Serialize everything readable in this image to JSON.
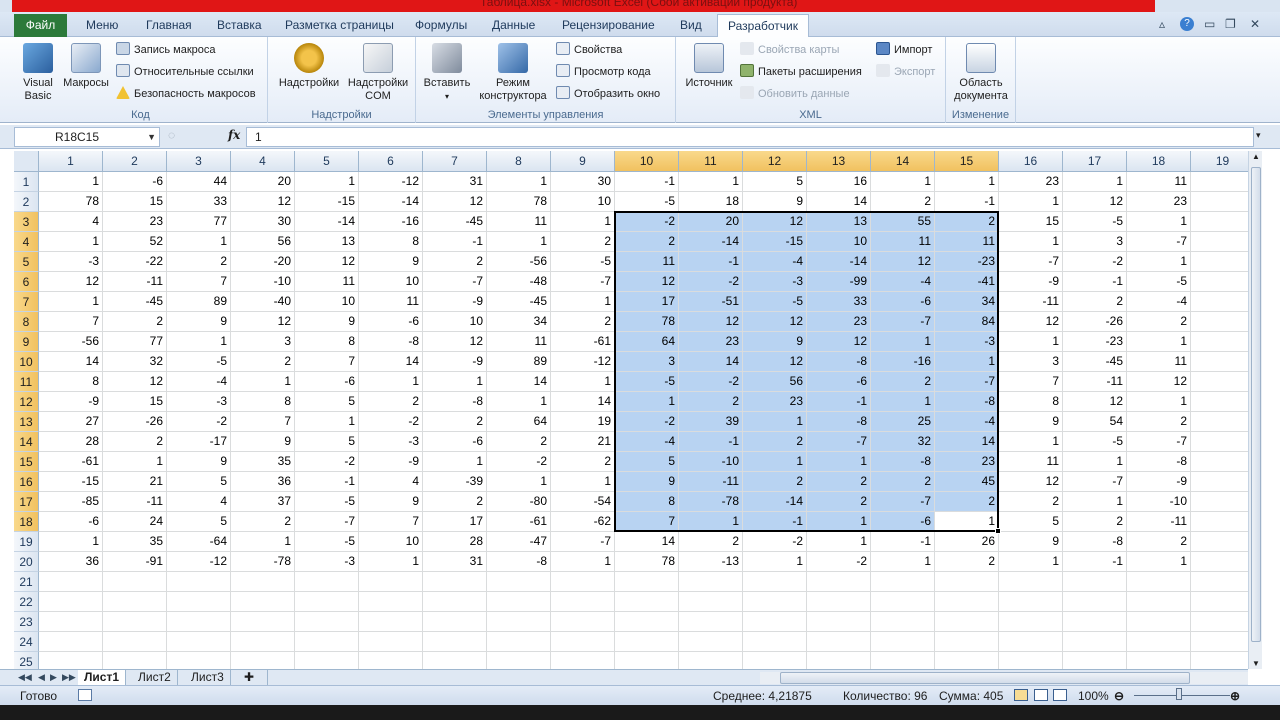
{
  "window": {
    "title": "Таблица.xlsx - Microsoft Excel (Сбой активации продукта)"
  },
  "tabs": {
    "file": "Файл",
    "items": [
      "Меню",
      "Главная",
      "Вставка",
      "Разметка страницы",
      "Формулы",
      "Данные",
      "Рецензирование",
      "Вид",
      "Разработчик"
    ],
    "active": "Разработчик"
  },
  "ribbon": {
    "code": {
      "label": "Код",
      "visual_basic": "Visual Basic",
      "macros": "Макросы",
      "record_macro": "Запись макроса",
      "relative_refs": "Относительные ссылки",
      "macro_security": "Безопасность макросов"
    },
    "addins": {
      "label": "Надстройки",
      "addins": "Надстройки",
      "com_addins": "Надстройки COM"
    },
    "controls": {
      "label": "Элементы управления",
      "insert": "Вставить",
      "design_mode": "Режим конструктора",
      "properties": "Свойства",
      "view_code": "Просмотр кода",
      "run_dialog": "Отобразить окно"
    },
    "xml": {
      "label": "XML",
      "source": "Источник",
      "map_properties": "Свойства карты",
      "expansion_packs": "Пакеты расширения",
      "refresh_data": "Обновить данные",
      "import": "Импорт",
      "export": "Экспорт"
    },
    "modify": {
      "label": "Изменение",
      "document_panel": "Область документа"
    }
  },
  "formula_bar": {
    "name_box": "R18C15",
    "fx": "fx",
    "value": "1"
  },
  "columns": [
    "1",
    "2",
    "3",
    "4",
    "5",
    "6",
    "7",
    "8",
    "9",
    "10",
    "11",
    "12",
    "13",
    "14",
    "15",
    "16",
    "17",
    "18",
    "19"
  ],
  "rows": [
    [
      "1",
      "-6",
      "44",
      "20",
      "1",
      "-12",
      "31",
      "1",
      "30",
      "-1",
      "1",
      "5",
      "16",
      "1",
      "1",
      "23",
      "1",
      "11",
      ""
    ],
    [
      "78",
      "15",
      "33",
      "12",
      "-15",
      "-14",
      "12",
      "78",
      "10",
      "-5",
      "18",
      "9",
      "14",
      "2",
      "-1",
      "1",
      "12",
      "23",
      ""
    ],
    [
      "4",
      "23",
      "77",
      "30",
      "-14",
      "-16",
      "-45",
      "11",
      "1",
      "-2",
      "20",
      "12",
      "13",
      "55",
      "2",
      "15",
      "-5",
      "1",
      ""
    ],
    [
      "1",
      "52",
      "1",
      "56",
      "13",
      "8",
      "-1",
      "1",
      "2",
      "2",
      "-14",
      "-15",
      "10",
      "11",
      "11",
      "1",
      "3",
      "-7",
      ""
    ],
    [
      "-3",
      "-22",
      "2",
      "-20",
      "12",
      "9",
      "2",
      "-56",
      "-5",
      "11",
      "-1",
      "-4",
      "-14",
      "12",
      "-23",
      "-7",
      "-2",
      "1",
      ""
    ],
    [
      "12",
      "-11",
      "7",
      "-10",
      "11",
      "10",
      "-7",
      "-48",
      "-7",
      "12",
      "-2",
      "-3",
      "-99",
      "-4",
      "-41",
      "-9",
      "-1",
      "-5",
      ""
    ],
    [
      "1",
      "-45",
      "89",
      "-40",
      "10",
      "11",
      "-9",
      "-45",
      "1",
      "17",
      "-51",
      "-5",
      "33",
      "-6",
      "34",
      "-11",
      "2",
      "-4",
      ""
    ],
    [
      "7",
      "2",
      "9",
      "12",
      "9",
      "-6",
      "10",
      "34",
      "2",
      "78",
      "12",
      "12",
      "23",
      "-7",
      "84",
      "12",
      "-26",
      "2",
      ""
    ],
    [
      "-56",
      "77",
      "1",
      "3",
      "8",
      "-8",
      "12",
      "11",
      "-61",
      "64",
      "23",
      "9",
      "12",
      "1",
      "-3",
      "1",
      "-23",
      "1",
      ""
    ],
    [
      "14",
      "32",
      "-5",
      "2",
      "7",
      "14",
      "-9",
      "89",
      "-12",
      "3",
      "14",
      "12",
      "-8",
      "-16",
      "1",
      "3",
      "-45",
      "11",
      ""
    ],
    [
      "8",
      "12",
      "-4",
      "1",
      "-6",
      "1",
      "1",
      "14",
      "1",
      "-5",
      "-2",
      "56",
      "-6",
      "2",
      "-7",
      "7",
      "-11",
      "12",
      ""
    ],
    [
      "-9",
      "15",
      "-3",
      "8",
      "5",
      "2",
      "-8",
      "1",
      "14",
      "1",
      "2",
      "23",
      "-1",
      "1",
      "-8",
      "8",
      "12",
      "1",
      ""
    ],
    [
      "27",
      "-26",
      "-2",
      "7",
      "1",
      "-2",
      "2",
      "64",
      "19",
      "-2",
      "39",
      "1",
      "-8",
      "25",
      "-4",
      "9",
      "54",
      "2",
      ""
    ],
    [
      "28",
      "2",
      "-17",
      "9",
      "5",
      "-3",
      "-6",
      "2",
      "21",
      "-4",
      "-1",
      "2",
      "-7",
      "32",
      "14",
      "1",
      "-5",
      "-7",
      ""
    ],
    [
      "-61",
      "1",
      "9",
      "35",
      "-2",
      "-9",
      "1",
      "-2",
      "2",
      "5",
      "-10",
      "1",
      "1",
      "-8",
      "23",
      "11",
      "1",
      "-8",
      ""
    ],
    [
      "-15",
      "21",
      "5",
      "36",
      "-1",
      "4",
      "-39",
      "1",
      "1",
      "9",
      "-11",
      "2",
      "2",
      "2",
      "45",
      "12",
      "-7",
      "-9",
      ""
    ],
    [
      "-85",
      "-11",
      "4",
      "37",
      "-5",
      "9",
      "2",
      "-80",
      "-54",
      "8",
      "-78",
      "-14",
      "2",
      "-7",
      "2",
      "2",
      "1",
      "-10",
      ""
    ],
    [
      "-6",
      "24",
      "5",
      "2",
      "-7",
      "7",
      "17",
      "-61",
      "-62",
      "7",
      "1",
      "-1",
      "1",
      "-6",
      "1",
      "5",
      "2",
      "-11",
      ""
    ],
    [
      "1",
      "35",
      "-64",
      "1",
      "-5",
      "10",
      "28",
      "-47",
      "-7",
      "14",
      "2",
      "-2",
      "1",
      "-1",
      "26",
      "9",
      "-8",
      "2",
      ""
    ],
    [
      "36",
      "-91",
      "-12",
      "-78",
      "-3",
      "1",
      "31",
      "-8",
      "1",
      "78",
      "-13",
      "1",
      "-2",
      "1",
      "2",
      "1",
      "-1",
      "1",
      ""
    ],
    [
      "",
      "",
      "",
      "",
      "",
      "",
      "",
      "",
      "",
      "",
      "",
      "",
      "",
      "",
      "",
      "",
      "",
      "",
      ""
    ],
    [
      "",
      "",
      "",
      "",
      "",
      "",
      "",
      "",
      "",
      "",
      "",
      "",
      "",
      "",
      "",
      "",
      "",
      "",
      ""
    ],
    [
      "",
      "",
      "",
      "",
      "",
      "",
      "",
      "",
      "",
      "",
      "",
      "",
      "",
      "",
      "",
      "",
      "",
      "",
      ""
    ],
    [
      "",
      "",
      "",
      "",
      "",
      "",
      "",
      "",
      "",
      "",
      "",
      "",
      "",
      "",
      "",
      "",
      "",
      "",
      ""
    ],
    [
      "",
      "",
      "",
      "",
      "",
      "",
      "",
      "",
      "",
      "",
      "",
      "",
      "",
      "",
      "",
      "",
      "",
      "",
      ""
    ]
  ],
  "selection": {
    "rows": [
      3,
      18
    ],
    "cols": [
      10,
      15
    ],
    "active_row": 18,
    "active_col": 15
  },
  "sheets": [
    "Лист1",
    "Лист2",
    "Лист3"
  ],
  "active_sheet": "Лист1",
  "status": {
    "ready": "Готово",
    "average": "Среднее: 4,21875",
    "count": "Количество: 96",
    "sum": "Сумма: 405",
    "zoom": "100%"
  }
}
